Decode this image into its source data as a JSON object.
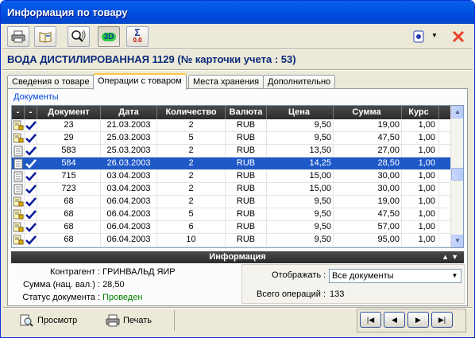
{
  "window": {
    "title": "Информация по товару"
  },
  "product": {
    "name": "ВОДА ДИСТИЛИРОВАННАЯ 1129 (№ карточки учета : 53)"
  },
  "toolbar": {
    "icons": [
      "printer-icon",
      "book-icon",
      "search-sound-icon",
      "3d-icon",
      "sum-icon"
    ],
    "sum_label": "Σ",
    "sum_sub": "0.0",
    "d3_label": "3D"
  },
  "tabs": [
    {
      "label": "Сведения о товаре"
    },
    {
      "label": "Операции с товаром",
      "active": true
    },
    {
      "label": "Места хранения"
    },
    {
      "label": "Дополнительно"
    }
  ],
  "documents": {
    "group_label": "Документы",
    "columns": [
      "-",
      "-",
      "Документ",
      "Дата",
      "Количество",
      "Валюта",
      "Цена",
      "Сумма",
      "Курс"
    ],
    "rows": [
      {
        "doc": "23",
        "date": "21.03.2003",
        "qty": "2",
        "cur": "RUB",
        "price": "9,50",
        "sum": "19,00",
        "rate": "1,00",
        "icon": "lock"
      },
      {
        "doc": "29",
        "date": "25.03.2003",
        "qty": "5",
        "cur": "RUB",
        "price": "9,50",
        "sum": "47,50",
        "rate": "1,00",
        "icon": "lock"
      },
      {
        "doc": "583",
        "date": "25.03.2003",
        "qty": "2",
        "cur": "RUB",
        "price": "13,50",
        "sum": "27,00",
        "rate": "1,00",
        "icon": "doc"
      },
      {
        "doc": "584",
        "date": "26.03.2003",
        "qty": "2",
        "cur": "RUB",
        "price": "14,25",
        "sum": "28,50",
        "rate": "1,00",
        "icon": "doc",
        "selected": true
      },
      {
        "doc": "715",
        "date": "03.04.2003",
        "qty": "2",
        "cur": "RUB",
        "price": "15,00",
        "sum": "30,00",
        "rate": "1,00",
        "icon": "doc"
      },
      {
        "doc": "723",
        "date": "03.04.2003",
        "qty": "2",
        "cur": "RUB",
        "price": "15,00",
        "sum": "30,00",
        "rate": "1,00",
        "icon": "doc"
      },
      {
        "doc": "68",
        "date": "06.04.2003",
        "qty": "2",
        "cur": "RUB",
        "price": "9,50",
        "sum": "19,00",
        "rate": "1,00",
        "icon": "lock"
      },
      {
        "doc": "68",
        "date": "06.04.2003",
        "qty": "5",
        "cur": "RUB",
        "price": "9,50",
        "sum": "47,50",
        "rate": "1,00",
        "icon": "lock"
      },
      {
        "doc": "68",
        "date": "06.04.2003",
        "qty": "6",
        "cur": "RUB",
        "price": "9,50",
        "sum": "57,00",
        "rate": "1,00",
        "icon": "lock"
      },
      {
        "doc": "68",
        "date": "06.04.2003",
        "qty": "10",
        "cur": "RUB",
        "price": "9,50",
        "sum": "95,00",
        "rate": "1,00",
        "icon": "lock"
      }
    ]
  },
  "info": {
    "header": "Информация",
    "counterparty_label": "Контрагент :",
    "counterparty_value": "ГРИНВАЛЬД ЯИР",
    "sum_label": "Сумма (нац. вал.) :",
    "sum_value": "28,50",
    "status_label": "Статус документа :",
    "status_value": "Проведен",
    "status_color": "#008000",
    "display_label": "Отображать :",
    "display_value": "Все документы",
    "total_label": "Всего операций :",
    "total_value": "133"
  },
  "bottom": {
    "preview_label": "Просмотр",
    "print_label": "Печать"
  },
  "nav": [
    "first-icon",
    "prev-icon",
    "next-icon",
    "last-icon"
  ]
}
